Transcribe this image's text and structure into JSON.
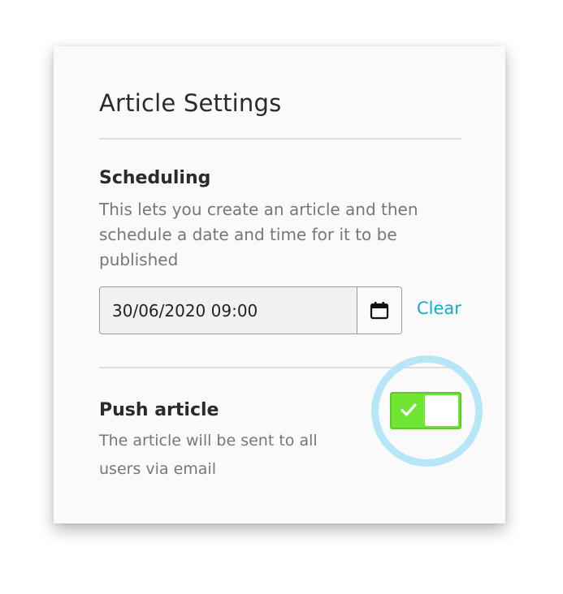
{
  "panel": {
    "title": "Article Settings"
  },
  "scheduling": {
    "title": "Scheduling",
    "description": "This lets you create an article and then schedule a date and time for it to be published",
    "date_value": "30/06/2020 09:00",
    "calendar_icon": "calendar-icon",
    "clear_label": "Clear"
  },
  "push": {
    "title": "Push article",
    "description": "The article will be sent to all users via email",
    "toggle_on": true,
    "check_icon": "check-icon"
  },
  "colors": {
    "accent_link": "#1ba8d6",
    "toggle_on": "#6fe633",
    "highlight_ring": "#b7e6f7"
  }
}
